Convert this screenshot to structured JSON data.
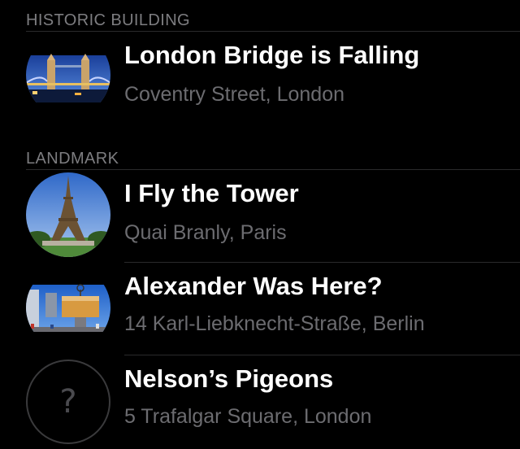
{
  "sections": [
    {
      "header": "HISTORIC BUILDING",
      "items": [
        {
          "title": "London Bridge is Falling",
          "subtitle": "Coventry Street, London",
          "image": "tower-bridge-photo"
        }
      ]
    },
    {
      "header": "LANDMARK",
      "items": [
        {
          "title": "I Fly the Tower",
          "subtitle": "Quai Branly, Paris",
          "image": "eiffel-tower-photo"
        },
        {
          "title": "Alexander Was Here?",
          "subtitle": "14 Karl-Liebknecht-Straße, Berlin",
          "image": "alexanderplatz-world-clock-photo"
        },
        {
          "title": "Nelson’s Pigeons",
          "subtitle": "5 Trafalgar Square, London",
          "image": "placeholder-question-icon",
          "placeholder_glyph": "?"
        }
      ]
    }
  ]
}
